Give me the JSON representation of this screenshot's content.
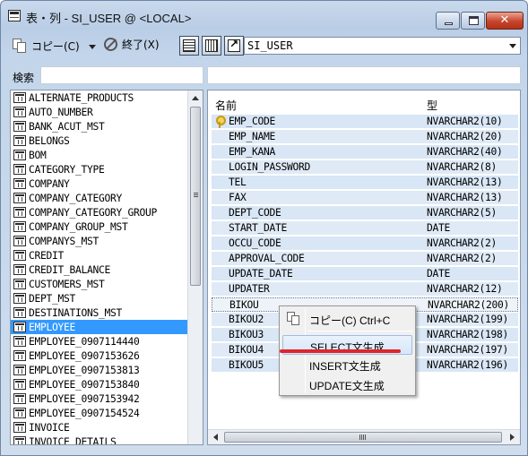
{
  "window": {
    "title": "表・列 - SI_USER @ <LOCAL>",
    "close_glyph": "✕"
  },
  "toolbar": {
    "copy_label": "コピー(C)",
    "exit_label": "終了(X)",
    "table_select_value": "SI_USER"
  },
  "search": {
    "label": "検索",
    "value": "",
    "column_filter_value": ""
  },
  "tables": [
    "ALTERNATE_PRODUCTS",
    "AUTO_NUMBER",
    "BANK_ACUT_MST",
    "BELONGS",
    "BOM",
    "CATEGORY_TYPE",
    "COMPANY",
    "COMPANY_CATEGORY",
    "COMPANY_CATEGORY_GROUP",
    "COMPANY_GROUP_MST",
    "COMPANYS_MST",
    "CREDIT",
    "CREDIT_BALANCE",
    "CUSTOMERS_MST",
    "DEPT_MST",
    "DESTINATIONS_MST",
    "EMPLOYEE",
    "EMPLOYEE_0907114440",
    "EMPLOYEE_0907153626",
    "EMPLOYEE_0907153813",
    "EMPLOYEE_0907153840",
    "EMPLOYEE_0907153942",
    "EMPLOYEE_0907154524",
    "INVOICE",
    "INVOICE_DETAILS"
  ],
  "selected_table_index": 16,
  "columns_header": {
    "name": "名前",
    "type": "型"
  },
  "columns": [
    {
      "name": "EMP_CODE",
      "type": "NVARCHAR2(10)",
      "primary_key": true
    },
    {
      "name": "EMP_NAME",
      "type": "NVARCHAR2(20)",
      "primary_key": false
    },
    {
      "name": "EMP_KANA",
      "type": "NVARCHAR2(40)",
      "primary_key": false
    },
    {
      "name": "LOGIN_PASSWORD",
      "type": "NVARCHAR2(8)",
      "primary_key": false
    },
    {
      "name": "TEL",
      "type": "NVARCHAR2(13)",
      "primary_key": false
    },
    {
      "name": "FAX",
      "type": "NVARCHAR2(13)",
      "primary_key": false
    },
    {
      "name": "DEPT_CODE",
      "type": "NVARCHAR2(5)",
      "primary_key": false
    },
    {
      "name": "START_DATE",
      "type": "DATE",
      "primary_key": false
    },
    {
      "name": "OCCU_CODE",
      "type": "NVARCHAR2(2)",
      "primary_key": false
    },
    {
      "name": "APPROVAL_CODE",
      "type": "NVARCHAR2(2)",
      "primary_key": false
    },
    {
      "name": "UPDATE_DATE",
      "type": "DATE",
      "primary_key": false
    },
    {
      "name": "UPDATER",
      "type": "NVARCHAR2(12)",
      "primary_key": false
    },
    {
      "name": "BIKOU",
      "type": "NVARCHAR2(200)",
      "primary_key": false
    },
    {
      "name": "BIKOU2",
      "type": "NVARCHAR2(199)",
      "primary_key": false
    },
    {
      "name": "BIKOU3",
      "type": "NVARCHAR2(198)",
      "primary_key": false
    },
    {
      "name": "BIKOU4",
      "type": "NVARCHAR2(197)",
      "primary_key": false
    },
    {
      "name": "BIKOU5",
      "type": "NVARCHAR2(196)",
      "primary_key": false
    }
  ],
  "focused_column_index": 12,
  "context_menu": {
    "copy": "コピー(C) Ctrl+C",
    "select": "SELECT文生成",
    "insert": "INSERT文生成",
    "update": "UPDATE文生成"
  },
  "colors": {
    "selection": "#3399ff",
    "row_fill": "#d8e6f5",
    "highlight_underline": "#e0242a"
  }
}
